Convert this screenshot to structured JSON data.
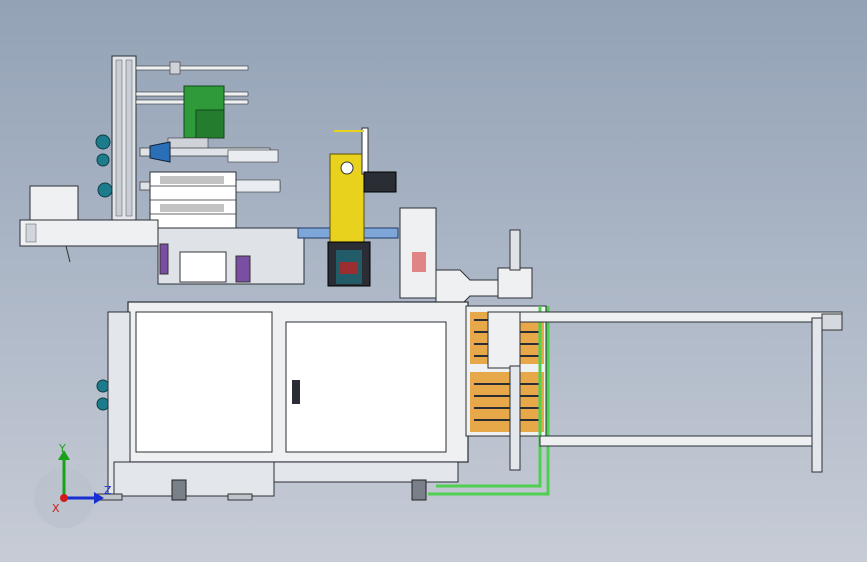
{
  "view": {
    "background_top": "#93a2b6",
    "background_bottom": "#c7ccd6"
  },
  "triad": {
    "x_label": "X",
    "y_label": "Y",
    "z_label": "Z",
    "x_color": "#d11a1a",
    "y_color": "#1aa11a",
    "z_color": "#1a2fd1"
  },
  "colors": {
    "frame": "#d9dde3",
    "frame_edge": "#3a3f47",
    "cabinet": "#eef0f2",
    "yellow_press": "#e8d21e",
    "green_motor": "#2e9a3a",
    "conveyor_green": "#4fcf4f",
    "orange_stock": "#e49b2b",
    "blue_plate": "#7fa6d8",
    "teal_reel": "#1d7c8c"
  }
}
